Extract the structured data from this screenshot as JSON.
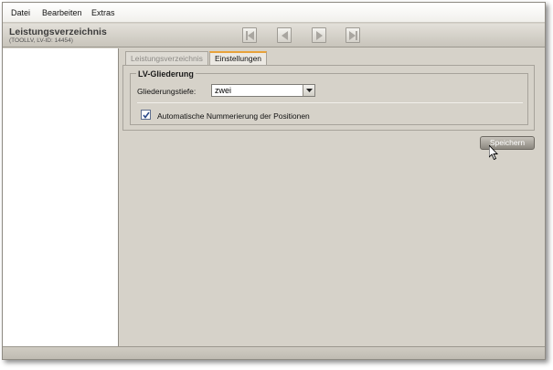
{
  "menu": {
    "items": [
      {
        "label": "Datei"
      },
      {
        "label": "Bearbeiten"
      },
      {
        "label": "Extras"
      }
    ]
  },
  "header": {
    "title": "Leistungsverzeichnis",
    "subtitle": "(TOOLLV, LV-ID: 14454)"
  },
  "navigation": {
    "buttons": [
      {
        "icon": "first-icon",
        "enabled": false
      },
      {
        "icon": "previous-icon",
        "enabled": false
      },
      {
        "icon": "next-icon",
        "enabled": false
      },
      {
        "icon": "last-icon",
        "enabled": false
      }
    ]
  },
  "tabs": [
    {
      "label": "Leistungsverzeichnis",
      "active": false
    },
    {
      "label": "Einstellungen",
      "active": true
    }
  ],
  "settings": {
    "group_title": "LV-Gliederung",
    "depth_label": "Gliederungstiefe:",
    "depth_value": "zwei",
    "numbering_label": "Automatische Nummerierung der Positionen",
    "numbering_checked": true
  },
  "actions": {
    "save_label": "Speichern"
  },
  "colors": {
    "active_tab_accent": "#e8a23a",
    "panel_background": "#d6d2c9"
  }
}
